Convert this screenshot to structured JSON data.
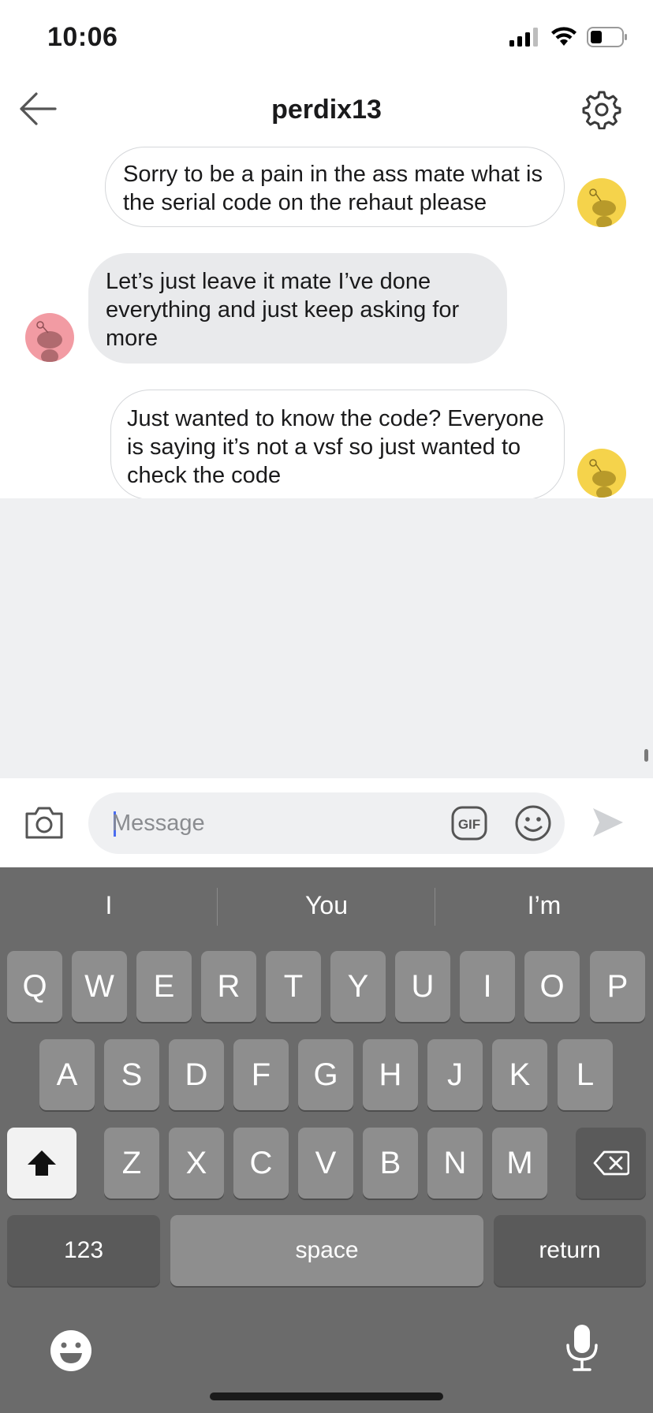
{
  "status_bar": {
    "time": "10:06"
  },
  "header": {
    "title": "perdix13"
  },
  "messages": [
    {
      "direction": "outgoing",
      "text": "Sorry to be a pain in the ass mate what is the serial code on the rehaut please",
      "avatar_color": "#f5d34b"
    },
    {
      "direction": "incoming",
      "text": "Let’s just leave it mate I’ve done everything and just keep asking for more",
      "avatar_color": "#f29ba3"
    },
    {
      "direction": "outgoing",
      "text": "Just wanted to know the code? Everyone is saying it’s not a vsf so just wanted to check the code",
      "avatar_color": "#f5d34b"
    }
  ],
  "composer": {
    "placeholder": "Message",
    "value": "",
    "gif_label": "GIF"
  },
  "keyboard": {
    "suggestions": [
      "I",
      "You",
      "I’m"
    ],
    "row1": [
      "Q",
      "W",
      "E",
      "R",
      "T",
      "Y",
      "U",
      "I",
      "O",
      "P"
    ],
    "row2": [
      "A",
      "S",
      "D",
      "F",
      "G",
      "H",
      "J",
      "K",
      "L"
    ],
    "row3": [
      "Z",
      "X",
      "C",
      "V",
      "B",
      "N",
      "M"
    ],
    "numbers_label": "123",
    "space_label": "space",
    "return_label": "return"
  }
}
